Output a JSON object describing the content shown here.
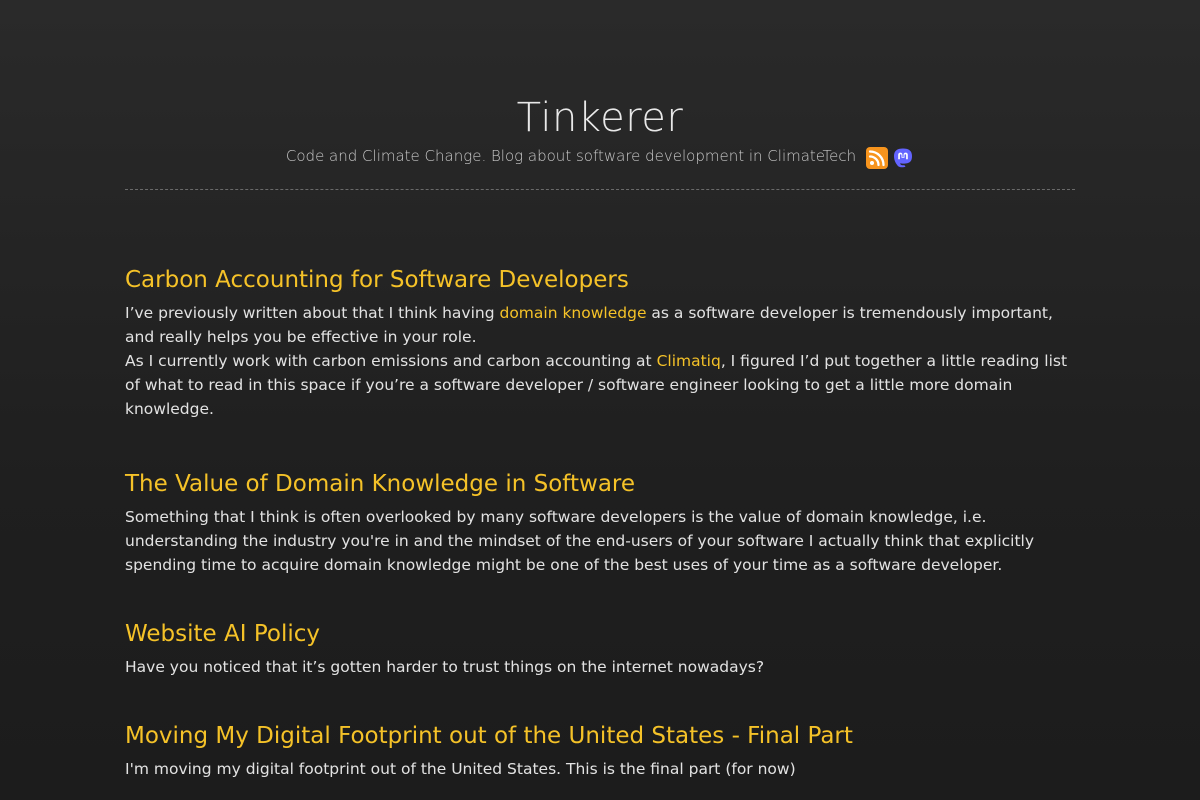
{
  "header": {
    "title": "Tinkerer",
    "subtitle": "Code and Climate Change. Blog about software development in ClimateTech",
    "icons": [
      "rss-icon",
      "mastodon-icon"
    ]
  },
  "colors": {
    "accent": "#f5c228",
    "background": "#232323",
    "text": "#e2e2e2",
    "rss": "#f7941d",
    "mastodon": "#6364ff"
  },
  "posts": [
    {
      "title": "Carbon Accounting for Software Developers",
      "line1_before": "I’ve previously written about that I think having ",
      "line1_link": "domain knowledge",
      "line1_after": " as a software developer is tremendously important, and really helps you be effective in your role.",
      "line2_before": "As I currently work with carbon emissions and carbon accounting at ",
      "line2_link": "Climatiq",
      "line2_after": ", I figured I’d put together a little reading list of what to read in this space if you’re a software developer / software engineer looking to get a little more domain knowledge."
    },
    {
      "title": "The Value of Domain Knowledge in Software",
      "body": "Something that I think is often overlooked by many software developers is the value of domain knowledge, i.e. understanding the industry you're in and the mindset of the end-users of your software I actually think that explicitly spending time to acquire domain knowledge might be one of the best uses of your time as a software developer."
    },
    {
      "title": "Website AI Policy",
      "body": "Have you noticed that it’s gotten harder to trust things on the internet nowadays?"
    },
    {
      "title": "Moving My Digital Footprint out of the United States - Final Part",
      "body": "I'm moving my digital footprint out of the United States. This is the final part (for now)"
    }
  ]
}
